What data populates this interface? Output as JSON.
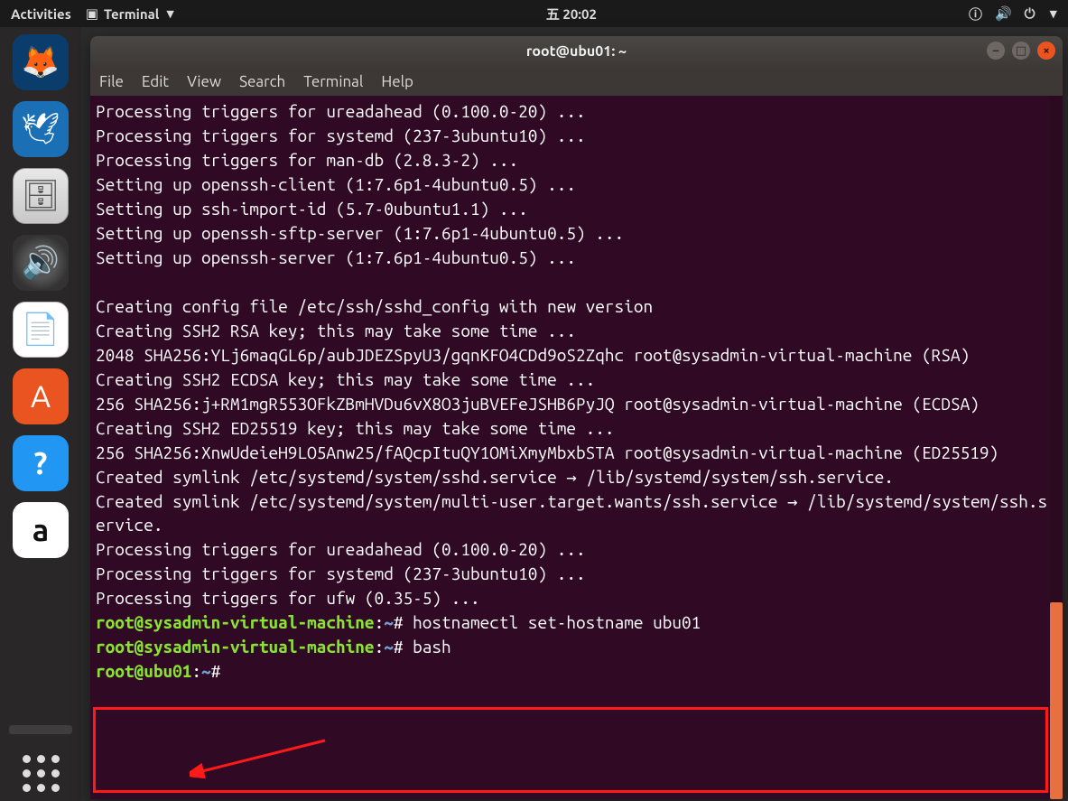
{
  "top_panel": {
    "activities": "Activities",
    "app_indicator": "Terminal",
    "clock": "五 20:02"
  },
  "dock": {
    "items": [
      {
        "name": "firefox",
        "glyph": "🦊"
      },
      {
        "name": "thunderbird",
        "glyph": "🕊"
      },
      {
        "name": "files",
        "glyph": "🗄"
      },
      {
        "name": "rhythmbox",
        "glyph": "🔊"
      },
      {
        "name": "writer",
        "glyph": "📄"
      },
      {
        "name": "software",
        "glyph": "A"
      },
      {
        "name": "help",
        "glyph": "?"
      },
      {
        "name": "amazon",
        "glyph": "a"
      }
    ]
  },
  "window": {
    "title": "root@ubu01: ~",
    "menu": [
      "File",
      "Edit",
      "View",
      "Search",
      "Terminal",
      "Help"
    ]
  },
  "terminal": {
    "lines": [
      "Processing triggers for ureadahead (0.100.0-20) ...",
      "Processing triggers for systemd (237-3ubuntu10) ...",
      "Processing triggers for man-db (2.8.3-2) ...",
      "Setting up openssh-client (1:7.6p1-4ubuntu0.5) ...",
      "Setting up ssh-import-id (5.7-0ubuntu1.1) ...",
      "Setting up openssh-sftp-server (1:7.6p1-4ubuntu0.5) ...",
      "Setting up openssh-server (1:7.6p1-4ubuntu0.5) ...",
      "",
      "Creating config file /etc/ssh/sshd_config with new version",
      "Creating SSH2 RSA key; this may take some time ...",
      "2048 SHA256:YLj6maqGL6p/aubJDEZSpyU3/gqnKFO4CDd9oS2Zqhc root@sysadmin-virtual-machine (RSA)",
      "Creating SSH2 ECDSA key; this may take some time ...",
      "256 SHA256:j+RM1mgR553OFkZBmHVDu6vX8O3juBVEFeJSHB6PyJQ root@sysadmin-virtual-machine (ECDSA)",
      "Creating SSH2 ED25519 key; this may take some time ...",
      "256 SHA256:XnwUdeieH9LO5Anw25/fAQcpItuQY1OMiXmyMbxbSTA root@sysadmin-virtual-machine (ED25519)",
      "Created symlink /etc/systemd/system/sshd.service → /lib/systemd/system/ssh.service.",
      "Created symlink /etc/systemd/system/multi-user.target.wants/ssh.service → /lib/systemd/system/ssh.service.",
      "Processing triggers for ureadahead (0.100.0-20) ...",
      "Processing triggers for systemd (237-3ubuntu10) ...",
      "Processing triggers for ufw (0.35-5) ..."
    ],
    "prompts": [
      {
        "user": "root",
        "host": "sysadmin-virtual-machine",
        "path": "~",
        "cmd": "hostnamectl set-hostname ubu01"
      },
      {
        "user": "root",
        "host": "sysadmin-virtual-machine",
        "path": "~",
        "cmd": "bash"
      },
      {
        "user": "root",
        "host": "ubu01",
        "path": "~",
        "cmd": ""
      }
    ]
  }
}
